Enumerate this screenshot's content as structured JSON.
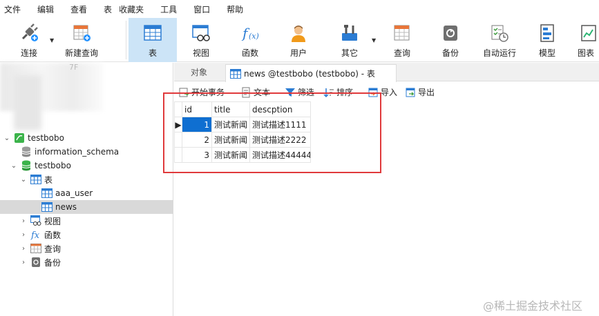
{
  "menu": [
    "文件",
    "编辑",
    "查看",
    "表",
    "收藏夹",
    "工具",
    "窗口",
    "帮助"
  ],
  "toolbar": {
    "connect": "连接",
    "new_query": "新建查询",
    "table": "表",
    "view": "视图",
    "function": "函数",
    "user": "用户",
    "other": "其它",
    "query": "查询",
    "backup": "备份",
    "auto_run": "自动运行",
    "model": "模型",
    "chart": "图表"
  },
  "tree": {
    "blurred_label": "7F",
    "connection": "testbobo",
    "databases": [
      "information_schema",
      "testbobo"
    ],
    "tables_group": "表",
    "tables": [
      "aaa_user",
      "news"
    ],
    "views_group": "视图",
    "functions_group": "函数",
    "queries_group": "查询",
    "backups_group": "备份"
  },
  "tabs": {
    "objects": "对象",
    "active": "news @testbobo (testbobo) - 表"
  },
  "subtoolbar": {
    "begin_transaction": "开始事务",
    "text": "文本",
    "filter": "筛选",
    "sort": "排序",
    "import": "导入",
    "export": "导出"
  },
  "grid": {
    "columns": [
      "id",
      "title",
      "descption"
    ],
    "rows": [
      [
        "1",
        "测试新闻",
        "测试描述1111"
      ],
      [
        "2",
        "测试新闻",
        "测试描述2222"
      ],
      [
        "3",
        "测试新闻",
        "测试描述44444"
      ]
    ]
  },
  "colors": {
    "highlight": "#cce4f7",
    "selection": "#0f6fd1",
    "annotation_box": "#e0393b"
  },
  "watermark": "@稀土掘金技术社区"
}
